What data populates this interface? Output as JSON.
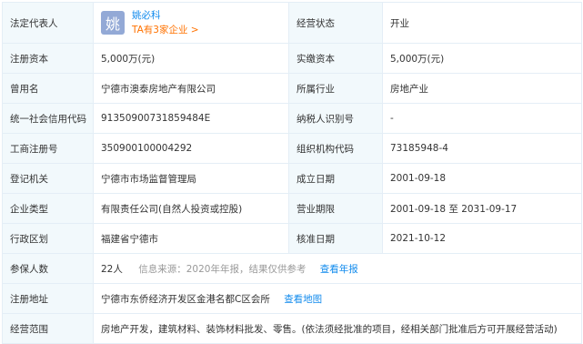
{
  "legal_rep": {
    "label": "法定代表人",
    "avatar_char": "姚",
    "name": "姚必科",
    "companies_link": "TA有3家企业 >"
  },
  "status": {
    "label": "经营状态",
    "value": "开业"
  },
  "registered_capital": {
    "label": "注册资本",
    "value": "5,000万(元)"
  },
  "paid_capital": {
    "label": "实缴资本",
    "value": "5,000万(元)"
  },
  "former_name": {
    "label": "曾用名",
    "value": "宁德市澳泰房地产有限公司"
  },
  "industry": {
    "label": "所属行业",
    "value": "房地产业"
  },
  "credit_code": {
    "label": "统一社会信用代码",
    "value": "91350900731859484E"
  },
  "taxpayer_id": {
    "label": "纳税人识别号",
    "value": "-"
  },
  "reg_number": {
    "label": "工商注册号",
    "value": "350900100004292"
  },
  "org_code": {
    "label": "组织机构代码",
    "value": "73185948-4"
  },
  "authority": {
    "label": "登记机关",
    "value": "宁德市市场监督管理局"
  },
  "founded": {
    "label": "成立日期",
    "value": "2001-09-18"
  },
  "company_type": {
    "label": "企业类型",
    "value": "有限责任公司(自然人投资或控股)"
  },
  "term": {
    "label": "营业期限",
    "value": "2001-09-18 至 2031-09-17"
  },
  "region": {
    "label": "行政区划",
    "value": "福建省宁德市"
  },
  "approval_date": {
    "label": "核准日期",
    "value": "2021-10-12"
  },
  "insured": {
    "label": "参保人数",
    "value": "22人",
    "note": "信息来源：2020年年报，结果仅供参考",
    "link": "查看年报"
  },
  "address": {
    "label": "注册地址",
    "value": "宁德市东侨经济开发区金港名都C区会所",
    "link": "查看地图"
  },
  "scope": {
    "label": "经营范围",
    "value": "房地产开发，建筑材料、装饰材料批发、零售。(依法须经批准的项目，经相关部门批准后方可开展经营活动)"
  },
  "colors": {
    "label_bg": "#f2f9fc",
    "border": "#e4eef6",
    "link": "#128bed",
    "orange_link": "#ff7200",
    "avatar_bg": "#93a9d6"
  }
}
